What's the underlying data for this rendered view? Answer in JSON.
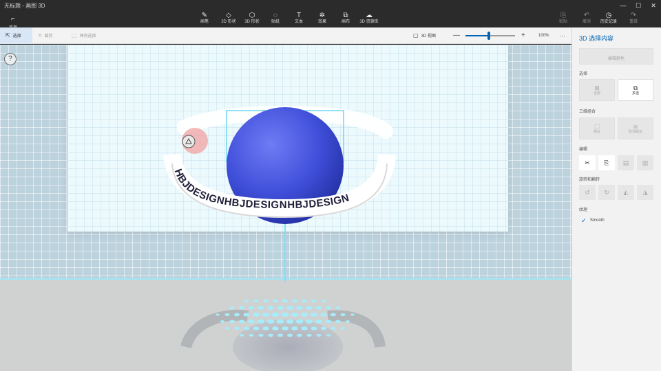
{
  "window": {
    "title": "无标题 - 画图 3D",
    "controls": [
      "—",
      "☐",
      "✕"
    ]
  },
  "ribbon": {
    "menu_label": "菜单",
    "tools": [
      {
        "label": "画笔",
        "icon": "brush-icon",
        "glyph": "✎"
      },
      {
        "label": "2D 形状",
        "icon": "shapes-2d-icon",
        "glyph": "◇"
      },
      {
        "label": "3D 形状",
        "icon": "shapes-3d-icon",
        "glyph": "⬡"
      },
      {
        "label": "贴纸",
        "icon": "sticker-icon",
        "glyph": "◌"
      },
      {
        "label": "文本",
        "icon": "text-icon",
        "glyph": "T"
      },
      {
        "label": "效果",
        "icon": "effects-icon",
        "glyph": "✲"
      },
      {
        "label": "画布",
        "icon": "canvas-icon",
        "glyph": "⧉"
      },
      {
        "label": "3D 资源库",
        "icon": "library-3d-icon",
        "glyph": "☁"
      }
    ],
    "right_tools": [
      {
        "label": "粘贴",
        "icon": "paste-icon",
        "glyph": "⎘",
        "enabled": false
      },
      {
        "label": "撤消",
        "icon": "undo-icon",
        "glyph": "↶",
        "enabled": false
      },
      {
        "label": "历史记录",
        "icon": "history-icon",
        "glyph": "◷",
        "enabled": true
      },
      {
        "label": "重做",
        "icon": "redo-icon",
        "glyph": "↷",
        "enabled": false
      }
    ]
  },
  "toolbar": {
    "select_label": "选择",
    "crop_label": "裁剪",
    "magic_select_label": "神奇选择",
    "view3d_label": "3D 视图",
    "zoom_minus": "—",
    "zoom_plus": "+",
    "zoom_value": "100%",
    "zoom_level": 0.47,
    "more": "···"
  },
  "canvas": {
    "help": "?",
    "ring_text": "HBJDESIGNHBJDESIGNHBJDESIGN",
    "ring_text_right": "HBJDESIGN",
    "colors": {
      "sphere": "#3f4fd9",
      "ring": "#ffffff",
      "ring_text": "#1f1f3a",
      "accent": "#0063b1",
      "handle": "#f3a2a2"
    }
  },
  "panel": {
    "title": "3D 选择内容",
    "edit_color": "编辑颜色",
    "sections": {
      "select": "选择",
      "group": "三维组合",
      "edit": "编辑",
      "rotate": "旋转和翻转",
      "texture": "纹理"
    },
    "select_all": "全部",
    "select_multi": "多选",
    "group": "组合",
    "ungroup": "取消组合",
    "texture_smooth": "Smooth",
    "texture_checked": true,
    "edit_icons": [
      "cut-icon",
      "copy-icon",
      "paste-icon",
      "delete-icon"
    ],
    "rotate_icons": [
      "rotate-left-icon",
      "rotate-right-icon",
      "flip-horizontal-icon",
      "flip-vertical-icon"
    ]
  }
}
